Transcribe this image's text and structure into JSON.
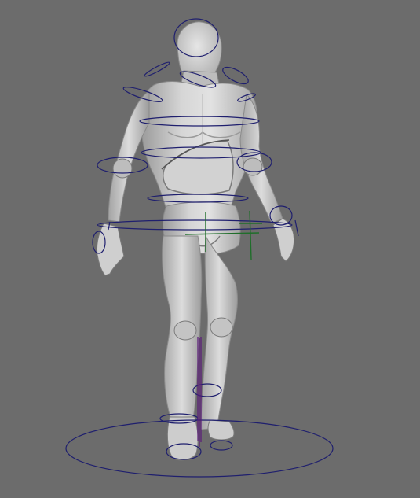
{
  "viewport": {
    "background": "#6c6c6c",
    "mesh_fill": "#c9c9c9",
    "mesh_shadow": "#8e8e8e",
    "mesh_highlight": "#e4e4e4",
    "control_color": "#1f1f6e",
    "pole_color": "#5a1a7a",
    "pivot_color": "#1f6e2a",
    "icons": [
      "root-control",
      "pelvis-control",
      "spine-control",
      "neck-control",
      "head-control",
      "clavicle-control",
      "arm-control",
      "hand-control",
      "leg-control",
      "foot-control",
      "pivot-manipulator"
    ]
  }
}
